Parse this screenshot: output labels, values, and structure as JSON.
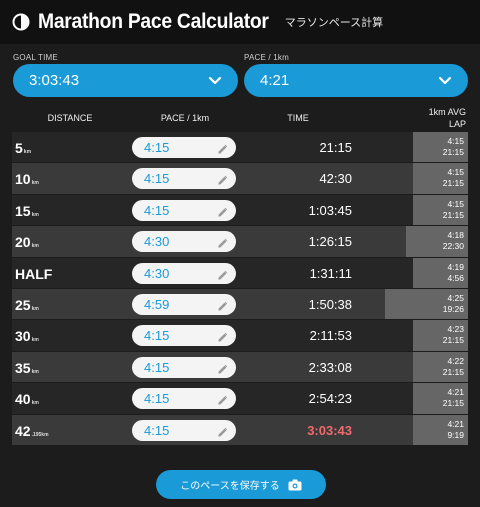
{
  "header": {
    "title": "Marathon Pace Calculator",
    "subtitle": "マラソンペース計算"
  },
  "goal": {
    "label": "GOAL TIME",
    "value": "3:03:43"
  },
  "pace": {
    "label": "PACE / 1km",
    "value": "4:21"
  },
  "columns": {
    "distance": "DISTANCE",
    "pace": "PACE / 1km",
    "time": "TIME",
    "lap_line1": "1km AVG",
    "lap_line2": "LAP"
  },
  "rows": [
    {
      "dist": "5",
      "unit": "km",
      "pace": "4:15",
      "time": "21:15",
      "avg": "4:15",
      "lap": "21:15",
      "lap_level": 0.4
    },
    {
      "dist": "10",
      "unit": "km",
      "pace": "4:15",
      "time": "42:30",
      "avg": "4:15",
      "lap": "21:15",
      "lap_level": 0.4
    },
    {
      "dist": "15",
      "unit": "km",
      "pace": "4:15",
      "time": "1:03:45",
      "avg": "4:15",
      "lap": "21:15",
      "lap_level": 0.4
    },
    {
      "dist": "20",
      "unit": "km",
      "pace": "4:30",
      "time": "1:26:15",
      "avg": "4:18",
      "lap": "22:30",
      "lap_level": 0.45
    },
    {
      "dist": "HALF",
      "unit": "",
      "pace": "4:30",
      "time": "1:31:11",
      "avg": "4:19",
      "lap": "4:56",
      "lap_level": 0.4
    },
    {
      "dist": "25",
      "unit": "km",
      "pace": "4:59",
      "time": "1:50:38",
      "avg": "4:25",
      "lap": "19:26",
      "lap_level": 0.6
    },
    {
      "dist": "30",
      "unit": "km",
      "pace": "4:15",
      "time": "2:11:53",
      "avg": "4:23",
      "lap": "21:15",
      "lap_level": 0.4
    },
    {
      "dist": "35",
      "unit": "km",
      "pace": "4:15",
      "time": "2:33:08",
      "avg": "4:22",
      "lap": "21:15",
      "lap_level": 0.4
    },
    {
      "dist": "40",
      "unit": "km",
      "pace": "4:15",
      "time": "2:54:23",
      "avg": "4:21",
      "lap": "21:15",
      "lap_level": 0.4
    },
    {
      "dist": "42",
      "unit": ".195km",
      "pace": "4:15",
      "time": "3:03:43",
      "avg": "4:21",
      "lap": "9:19",
      "lap_level": 0.4,
      "highlight": true
    }
  ],
  "save_button": {
    "label": "このペースを保存する"
  },
  "colors": {
    "accent": "#1a9ad6",
    "highlight_time": "#ef6b6b",
    "row_dark": "#262626",
    "row_light": "#3a3a3a",
    "lap_bar": "#666666"
  },
  "icons": {
    "logo": "half-moon-icon",
    "dropdown": "chevron-down-icon",
    "edit": "pencil-icon",
    "save": "camera-icon"
  }
}
